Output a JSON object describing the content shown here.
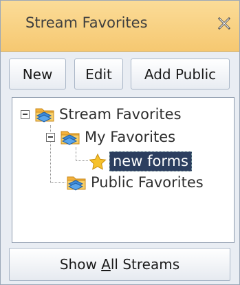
{
  "panel": {
    "title": "Stream Favorites",
    "close_icon": "close-x-icon"
  },
  "toolbar": {
    "new_label": "New",
    "edit_label": "Edit",
    "add_public_label": "Add Public"
  },
  "tree": {
    "root": {
      "label": "Stream Favorites",
      "icon": "favorites-folder-icon",
      "expanded": true
    },
    "my_favorites": {
      "label": "My Favorites",
      "icon": "favorites-folder-icon",
      "expanded": true
    },
    "item": {
      "label": "new forms",
      "icon": "star-icon",
      "selected": true
    },
    "public_favorites": {
      "label": "Public Favorites",
      "icon": "favorites-folder-icon"
    }
  },
  "footer": {
    "show_all_prefix": "Show ",
    "show_all_access_key": "A",
    "show_all_suffix": "ll Streams"
  },
  "colors": {
    "header_top": "#fbdc98",
    "header_bottom": "#f6c871",
    "selection": "#2c3e5f",
    "panel_bg": "#e9edf3"
  }
}
